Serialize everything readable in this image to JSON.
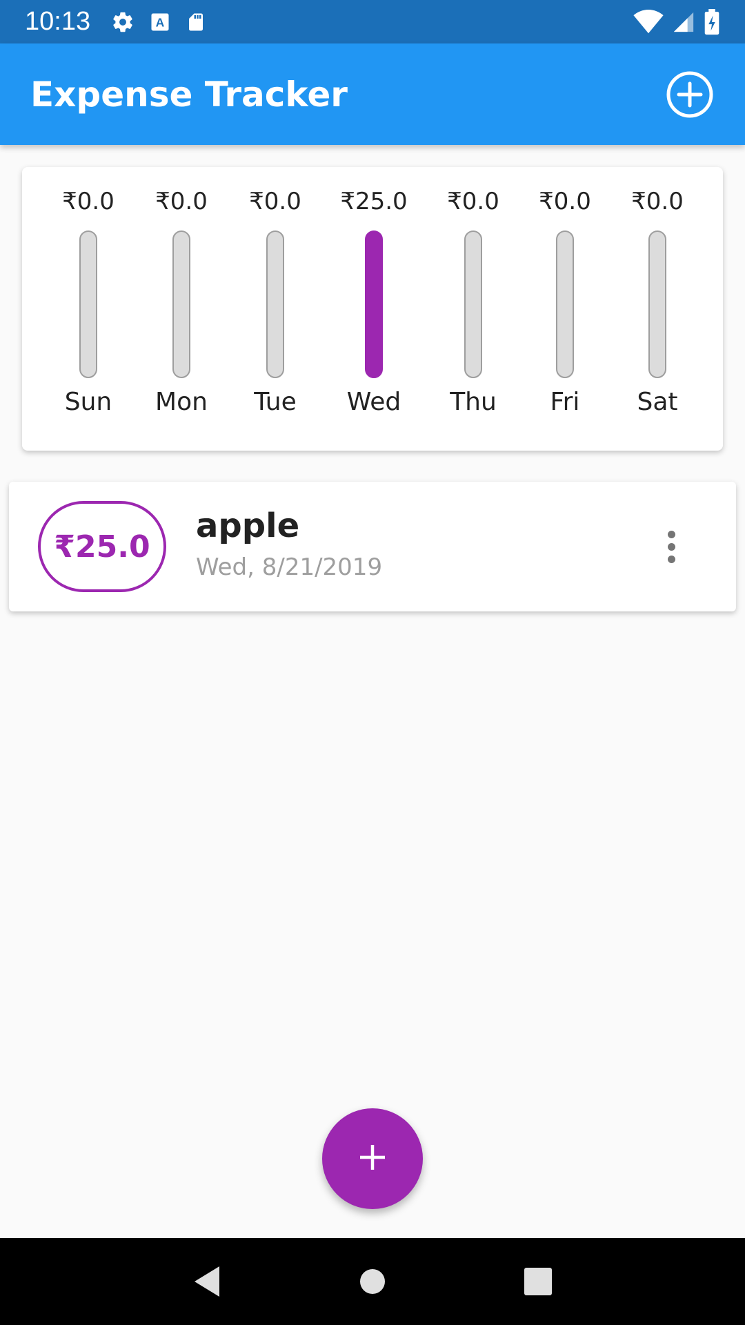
{
  "status_bar": {
    "time": "10:13",
    "left_icons": [
      "gear-icon",
      "keyboard-a-icon",
      "sd-card-icon"
    ],
    "right_icons": [
      "wifi-icon",
      "signal-icon",
      "battery-charging-icon"
    ],
    "background": "#1b6fb8"
  },
  "app_bar": {
    "title": "Expense Tracker",
    "add_icon": "add-circle-outline-icon",
    "background": "#2196f3"
  },
  "chart": {
    "accent": "#9c27b0",
    "days": [
      {
        "label": "Sun",
        "amount": "₹0.0",
        "fraction": 0
      },
      {
        "label": "Mon",
        "amount": "₹0.0",
        "fraction": 0
      },
      {
        "label": "Tue",
        "amount": "₹0.0",
        "fraction": 0
      },
      {
        "label": "Wed",
        "amount": "₹25.0",
        "fraction": 1
      },
      {
        "label": "Thu",
        "amount": "₹0.0",
        "fraction": 0
      },
      {
        "label": "Fri",
        "amount": "₹0.0",
        "fraction": 0
      },
      {
        "label": "Sat",
        "amount": "₹0.0",
        "fraction": 0
      }
    ]
  },
  "transactions": [
    {
      "amount": "₹25.0",
      "title": "apple",
      "date": "Wed, 8/21/2019",
      "menu_icon": "more-vert-icon"
    }
  ],
  "fab": {
    "icon": "plus-icon",
    "color": "#9c27b0"
  },
  "nav_bar": {
    "icons": [
      "back-triangle-icon",
      "home-circle-icon",
      "recents-square-icon"
    ]
  }
}
